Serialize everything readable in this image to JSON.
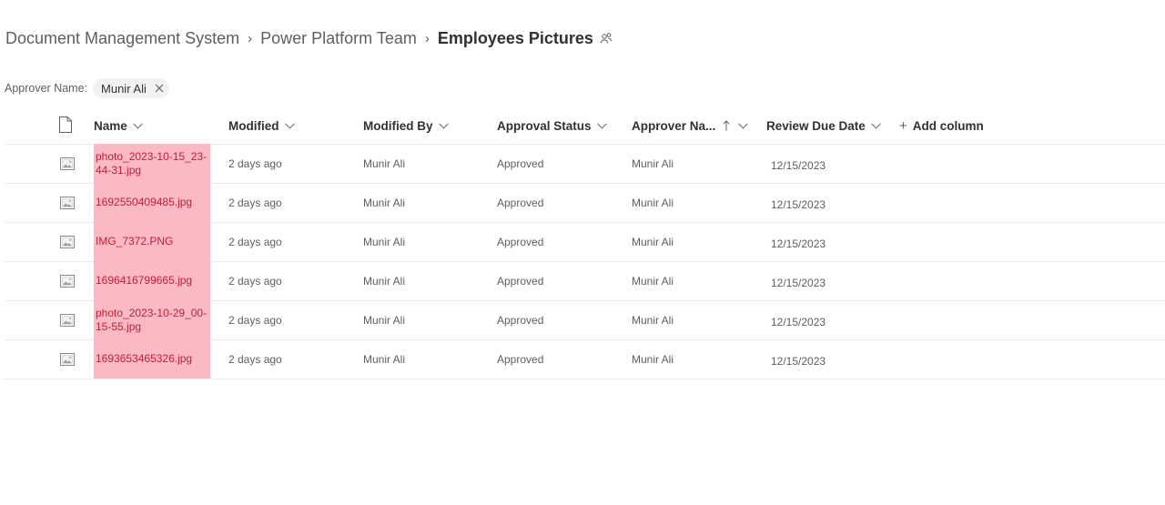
{
  "breadcrumb": {
    "items": [
      "Document Management System",
      "Power Platform Team"
    ],
    "current": "Employees Pictures"
  },
  "filter": {
    "label": "Approver Name:",
    "value": "Munir Ali"
  },
  "columns": {
    "name": "Name",
    "modified": "Modified",
    "modified_by": "Modified By",
    "approval_status": "Approval Status",
    "approver_name": "Approver Na...",
    "review_due_date": "Review Due Date",
    "add_column": "Add column"
  },
  "rows": [
    {
      "name": "photo_2023-10-15_23-44-31.jpg",
      "modified": "2 days ago",
      "modified_by": "Munir Ali",
      "status": "Approved",
      "approver": "Munir Ali",
      "due": "12/15/2023"
    },
    {
      "name": "1692550409485.jpg",
      "modified": "2 days ago",
      "modified_by": "Munir Ali",
      "status": "Approved",
      "approver": "Munir Ali",
      "due": "12/15/2023"
    },
    {
      "name": "IMG_7372.PNG",
      "modified": "2 days ago",
      "modified_by": "Munir Ali",
      "status": "Approved",
      "approver": "Munir Ali",
      "due": "12/15/2023"
    },
    {
      "name": "1696416799665.jpg",
      "modified": "2 days ago",
      "modified_by": "Munir Ali",
      "status": "Approved",
      "approver": "Munir Ali",
      "due": "12/15/2023"
    },
    {
      "name": "photo_2023-10-29_00-15-55.jpg",
      "modified": "2 days ago",
      "modified_by": "Munir Ali",
      "status": "Approved",
      "approver": "Munir Ali",
      "due": "12/15/2023"
    },
    {
      "name": "1693653465326.jpg",
      "modified": "2 days ago",
      "modified_by": "Munir Ali",
      "status": "Approved",
      "approver": "Munir Ali",
      "due": "12/15/2023"
    }
  ],
  "icons": {
    "file_type_header": "document-icon",
    "row_file": "image-file-icon",
    "sort": "sort-ascending-icon",
    "people": "people-icon"
  },
  "colors": {
    "highlight": "#fbb9c3",
    "highlight_text": "#c0203a",
    "divider": "#edebe9"
  }
}
